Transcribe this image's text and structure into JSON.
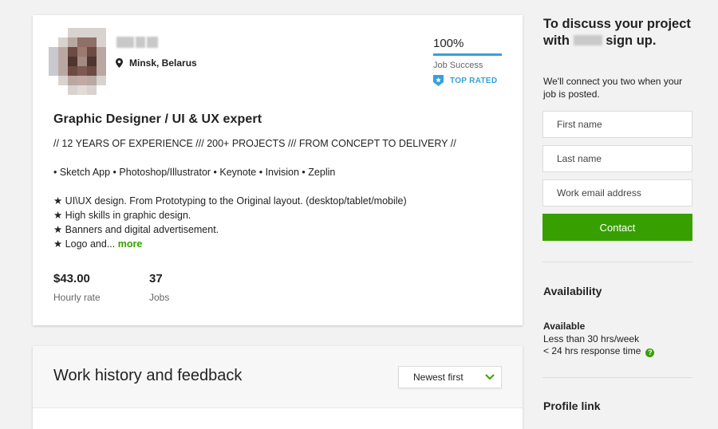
{
  "profile": {
    "location": "Minsk, Belarus",
    "job_success": {
      "value": "100%",
      "label": "Job Success",
      "fraction": 1.0
    },
    "badge": "TOP RATED",
    "title": "Graphic Designer / UI & UX expert",
    "description": [
      "// 12 YEARS OF EXPERIENCE /// 200+ PROJECTS /// FROM CONCEPT TO DELIVERY //",
      "",
      "• Sketch App • Photoshop/Illustrator • Keynote • Invision • Zeplin",
      "",
      "★ UI\\UX design. From Prototyping to the Original layout. (desktop/tablet/mobile)",
      "★ High skills in graphic design.",
      "★ Banners and digital advertisement."
    ],
    "last_line": "★ Logo and...",
    "more_label": "more",
    "hourly_rate": {
      "value": "$43.00",
      "label": "Hourly rate"
    },
    "jobs": {
      "value": "37",
      "label": "Jobs"
    }
  },
  "history": {
    "title": "Work history and feedback",
    "sort_selected": "Newest first"
  },
  "sidebar": {
    "heading_before": "To discuss your project with",
    "heading_after": "sign up.",
    "subtext": "We'll connect you two when your job is posted.",
    "first_name_placeholder": "First name",
    "last_name_placeholder": "Last name",
    "email_placeholder": "Work email address",
    "contact_label": "Contact",
    "availability_title": "Availability",
    "available_label": "Available",
    "hours": "Less than 30 hrs/week",
    "response": "< 24 hrs response time",
    "help_glyph": "?",
    "profile_link_title": "Profile link"
  },
  "colors": {
    "accent_green": "#37a000",
    "accent_blue": "#37a0db"
  }
}
